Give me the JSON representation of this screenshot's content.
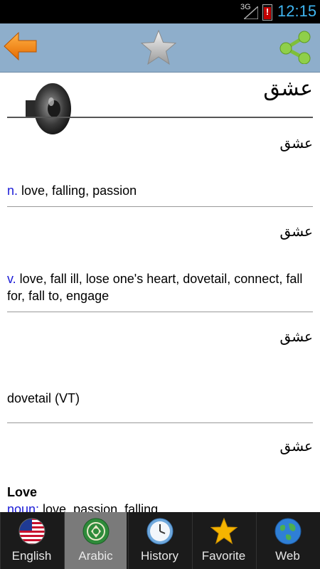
{
  "status_bar": {
    "network": "3G",
    "battery_mark": "!",
    "time": "12:15"
  },
  "action_bar": {
    "back_icon": "orange-back-arrow",
    "favorite_icon": "gray-star",
    "share_icon": "share"
  },
  "word": {
    "headword": "عشق",
    "speaker_icon": "speaker"
  },
  "entries": [
    {
      "arabic": "عشق",
      "pos": "n.",
      "definition": " love, falling, passion"
    },
    {
      "arabic": "عشق",
      "pos": "v.",
      "definition": " love, fall ill, lose one's heart, dovetail, connect, fall for, fall to, engage"
    },
    {
      "arabic": "عشق",
      "definition": "dovetail (VT)"
    },
    {
      "arabic": "عشق",
      "title": "Love",
      "pos": "noun:",
      "definition": " love, passion, falling"
    }
  ],
  "tabs": [
    {
      "label": "English",
      "icon": "us-flag"
    },
    {
      "label": "Arabic",
      "icon": "arab-league-emblem",
      "selected": true
    },
    {
      "label": "History",
      "icon": "clock"
    },
    {
      "label": "Favorite",
      "icon": "star"
    },
    {
      "label": "Web",
      "icon": "globe"
    }
  ],
  "colors": {
    "action_bar": "#8eaecb",
    "pos_blue": "#1a1ad6",
    "title_red": "#a01010",
    "time_blue": "#3fb5f0"
  }
}
